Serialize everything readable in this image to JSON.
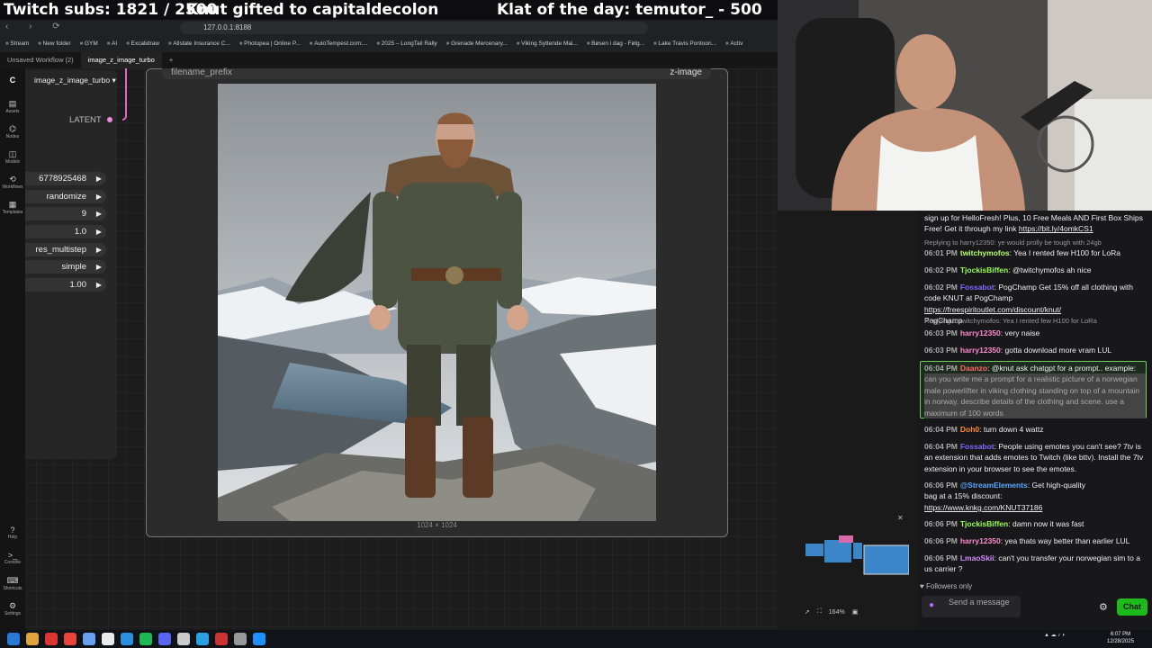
{
  "overlay": {
    "subs": "Twitch subs: 1821 / 2500",
    "gift": "Knut gifted to capitaldecolon",
    "klat": "Klat of the day: temutor_ - 500"
  },
  "browser": {
    "url": "127.0.0.1:8188",
    "bookmarks": [
      "Stream",
      "New folder",
      "GYM",
      "AI",
      "Excalidraw",
      "Allstate Insurance C...",
      "Photopea | Online P...",
      "AutoTempest.com:...",
      "2025 – LongTail Rally",
      "Grenade Mercenary...",
      "Viking Syttende Mai...",
      "Bøsen i dag - Følg...",
      "Lake Travis Pontoon...",
      "Activ"
    ],
    "tabs": [
      "Unsaved Workflow (2)",
      "image_z_image_turbo"
    ],
    "new_tab": "+"
  },
  "comfy": {
    "sidebar": [
      "Assets",
      "Nodes",
      "Models",
      "Workflows",
      "Templates"
    ],
    "sidebar_bottom": [
      "Help",
      "Console",
      "Shortcuts",
      "Settings"
    ],
    "workflow_selector": "image_z_image_turbo",
    "latent_label": "LATENT",
    "widgets": [
      "6778925468",
      "randomize",
      "9",
      "1.0",
      "res_multistep",
      "simple",
      "1.00"
    ],
    "save_node": {
      "prefix_label": "filename_prefix",
      "prefix_value": "z-image",
      "image_size": "1024 × 1024"
    },
    "zoom": "164%"
  },
  "chat": {
    "top_message": "sign up for HelloFresh! Plus, 10 Free Meals AND First Box Ships Free! Get it through my link",
    "top_link": "https://bit.ly/4omkCS1",
    "messages": [
      {
        "reply": "Replying to harry12350: ye would prolly be tough with 24gb"
      },
      {
        "time": "06:01 PM",
        "user": "twitchymofos",
        "color": "#b4ff6b",
        "text": "Yea I rented few H100 for LoRa"
      },
      {
        "time": "06:02 PM",
        "user": "TjockisBiffen",
        "color": "#9aff52",
        "text": "@twitchymofos ah nice"
      },
      {
        "time": "06:02 PM",
        "user": "Fossabot",
        "color": "#7b6bff",
        "text": "PogChamp Get 15% off all clothing with code KNUT at PogChamp",
        "link": "https://freespiritoutlet.com/discount/knut/",
        "after": "PogChamp"
      },
      {
        "reply": "Replying to twitchymofos: Yea I rented few H100 for LoRa"
      },
      {
        "time": "06:03 PM",
        "user": "harry12350",
        "color": "#ff8bd0",
        "text": "very naise"
      },
      {
        "time": "06:03 PM",
        "user": "harry12350",
        "color": "#ff8bd0",
        "text": "gotta download more vram LUL"
      },
      {
        "time": "06:04 PM",
        "user": "Daanzo",
        "color": "#ff6a6a",
        "text": "@knut ask chatgpt for a prompt.. example:",
        "highlight": "can you write me a prompt for a realistic picture of a norwegian male powerlifter in viking clothing standing on top of a mountain in norway. describe details of the clothing and scene. use a maximum of 100 words"
      },
      {
        "time": "06:04 PM",
        "user": "Doh0",
        "color": "#ff8a3a",
        "text": "turn down 4 wattz"
      },
      {
        "time": "06:04 PM",
        "user": "Fossabot",
        "color": "#7b6bff",
        "text": "People using emotes you can't see? 7tv is an extension that adds emotes to Twitch (like bttv). Install the 7tv extension in your browser to see the emotes."
      },
      {
        "time": "06:06 PM",
        "user": "@StreamElements",
        "color": "#5aa9ff",
        "text": "Get high-quality",
        "text2": "bag at a 15% discount:",
        "link": "https://www.knkg.com/KNUT37186"
      },
      {
        "time": "06:06 PM",
        "user": "TjockisBiffen",
        "color": "#9aff52",
        "text": "damn now it was fast"
      },
      {
        "time": "06:06 PM",
        "user": "harry12350",
        "color": "#ff8bd0",
        "text": "yea thats way better than earlier LUL"
      },
      {
        "time": "06:06 PM",
        "user": "LmaoSkii",
        "color": "#d58cff",
        "text": "can't you transfer your norwegian sim to a us carrier ?"
      }
    ],
    "followers_only": "Followers only",
    "input_placeholder": "Send a message",
    "chat_button": "Chat"
  },
  "taskbar": {
    "time": "6:07 PM",
    "date": "12/28/2025"
  },
  "colors": {
    "chat_button": "#1dba1d",
    "highlight_border": "#6bcf5a",
    "wire": "#e267c6"
  }
}
